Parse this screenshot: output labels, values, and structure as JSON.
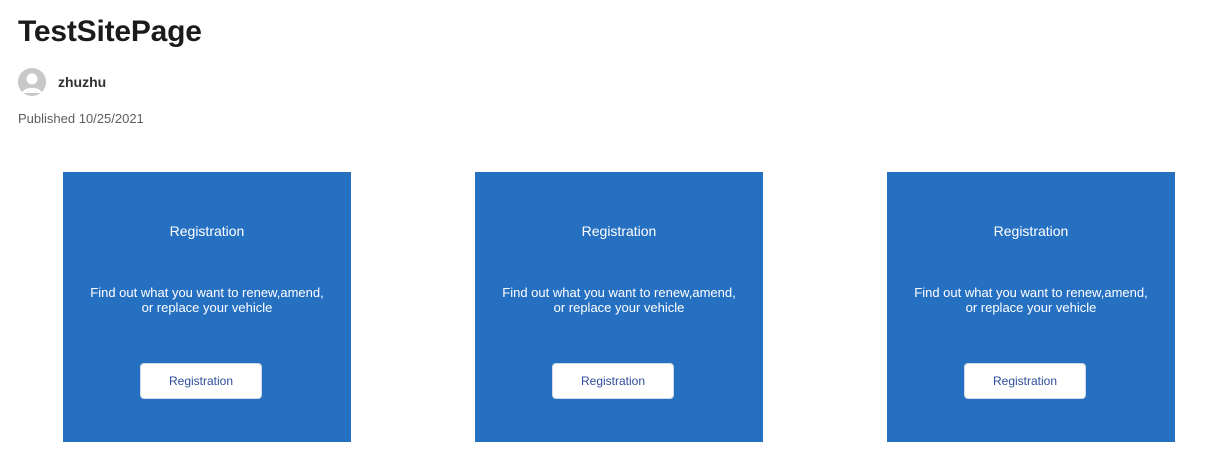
{
  "page": {
    "title": "TestSitePage",
    "author": "zhuzhu",
    "published": "Published 10/25/2021"
  },
  "cards": [
    {
      "title": "Registration",
      "description_line1": "Find out what you want to renew,amend,",
      "description_line2": "or replace your vehicle",
      "button_label": "Registration"
    },
    {
      "title": "Registration",
      "description_line1": "Find out what you want to renew,amend,",
      "description_line2": "or replace your vehicle",
      "button_label": "Registration"
    },
    {
      "title": "Registration",
      "description_line1": "Find out what you want to renew,amend,",
      "description_line2": "or replace your vehicle",
      "button_label": "Registration"
    }
  ],
  "colors": {
    "card_background": "#2670c2",
    "button_text": "#2f4c9a"
  },
  "icons": {
    "avatar": "person-icon"
  }
}
